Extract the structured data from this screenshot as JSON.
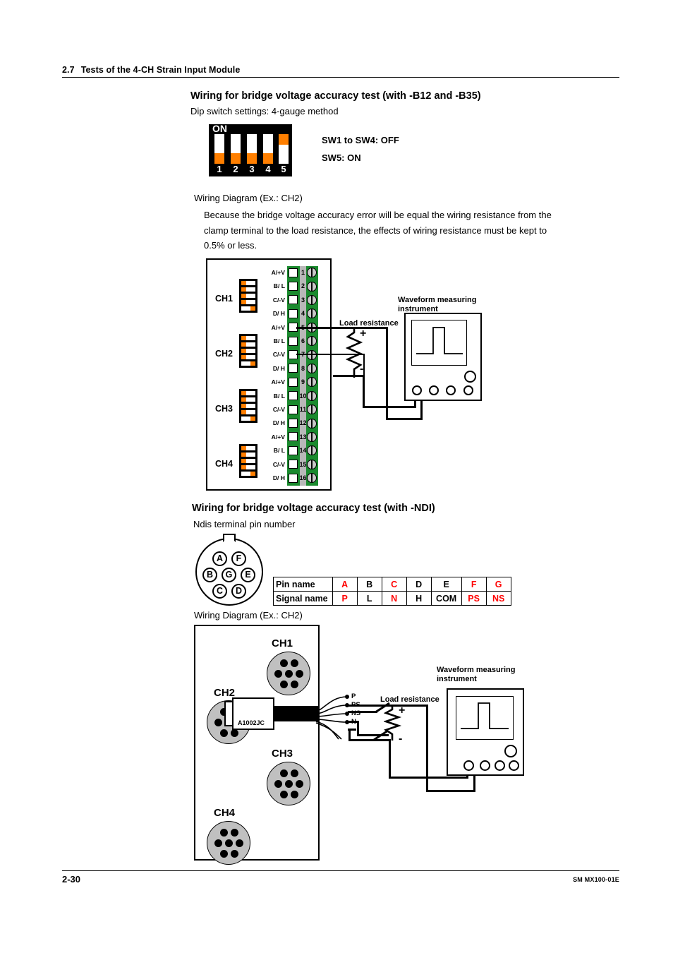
{
  "header": {
    "section_number": "2.7",
    "section_title": "Tests of the 4-CH Strain Input Module"
  },
  "section_b12": {
    "heading": "Wiring for bridge voltage accuracy test  (with -B12 and -B35)",
    "dip_caption": "Dip switch settings: 4-gauge method",
    "dipswitch": {
      "on_label": "ON",
      "switches": [
        {
          "number": "1",
          "state": "OFF"
        },
        {
          "number": "2",
          "state": "OFF"
        },
        {
          "number": "3",
          "state": "OFF"
        },
        {
          "number": "4",
          "state": "OFF"
        },
        {
          "number": "5",
          "state": "ON"
        }
      ],
      "note_1": "SW1 to SW4: OFF",
      "note_2": "SW5: ON"
    },
    "wiring_diagram_caption": "Wiring Diagram  (Ex.: CH2)",
    "paragraph_lines": [
      "Because the bridge voltage accuracy error will be equal the wiring resistance from the",
      "clamp terminal to the load resistance, the effects of wiring resistance must be kept to",
      "0.5% or less."
    ]
  },
  "clamp_figure": {
    "channel_labels": [
      "CH1",
      "CH2",
      "CH3",
      "CH4"
    ],
    "minidip_states_per_channel": [
      "OFF",
      "OFF",
      "OFF",
      "OFF",
      "ON"
    ],
    "terminal_rows": [
      {
        "number": "1",
        "name": "A/+V"
      },
      {
        "number": "2",
        "name": "B/ L"
      },
      {
        "number": "3",
        "name": "C/-V"
      },
      {
        "number": "4",
        "name": "D/ H"
      },
      {
        "number": "5",
        "name": "A/+V"
      },
      {
        "number": "6",
        "name": "B/ L"
      },
      {
        "number": "7",
        "name": "C/-V"
      },
      {
        "number": "8",
        "name": "D/ H"
      },
      {
        "number": "9",
        "name": "A/+V"
      },
      {
        "number": "10",
        "name": "B/ L"
      },
      {
        "number": "11",
        "name": "C/-V"
      },
      {
        "number": "12",
        "name": "D/ H"
      },
      {
        "number": "13",
        "name": "A/+V"
      },
      {
        "number": "14",
        "name": "B/ L"
      },
      {
        "number": "15",
        "name": "C/-V"
      },
      {
        "number": "16",
        "name": "D/ H"
      }
    ],
    "load_resistance_label": "Load resistance",
    "plus_sign": "+",
    "minus_sign": "-",
    "instrument_label_line1": "Waveform measuring",
    "instrument_label_line2": "instrument"
  },
  "section_ndi": {
    "heading": "Wiring for bridge voltage accuracy test  (with -NDI)",
    "pin_caption": "Ndis terminal pin number",
    "connector_pins": [
      "A",
      "F",
      "B",
      "G",
      "E",
      "C",
      "D"
    ],
    "pin_table": {
      "row_labels": [
        "Pin name",
        "Signal name"
      ],
      "pin_names": [
        "A",
        "B",
        "C",
        "D",
        "E",
        "F",
        "G"
      ],
      "signal_names": [
        "P",
        "L",
        "N",
        "H",
        "COM",
        "PS",
        "NS"
      ],
      "highlighted_columns": [
        0,
        2,
        5,
        6
      ],
      "highlight_color": "#ff0000"
    },
    "wiring_diagram_caption": "Wiring Diagram  (Ex.: CH2)"
  },
  "ndis_figure": {
    "channel_labels": [
      "CH1",
      "CH2",
      "CH3",
      "CH4"
    ],
    "plug_label": "A1002JC",
    "lead_labels": [
      "P",
      "PS",
      "NS",
      "N"
    ],
    "load_resistance_label": "Load resistance",
    "plus_sign": "+",
    "minus_sign": "-",
    "instrument_label_line1": "Waveform measuring",
    "instrument_label_line2": "instrument"
  },
  "footer": {
    "page_number": "2-30",
    "document_code": "SM MX100-01E"
  },
  "colors": {
    "dip_orange": "#FF7F00",
    "terminal_green": "#1a8a2e",
    "connector_gray": "#c0c0c0",
    "table_red": "#ff0000"
  }
}
